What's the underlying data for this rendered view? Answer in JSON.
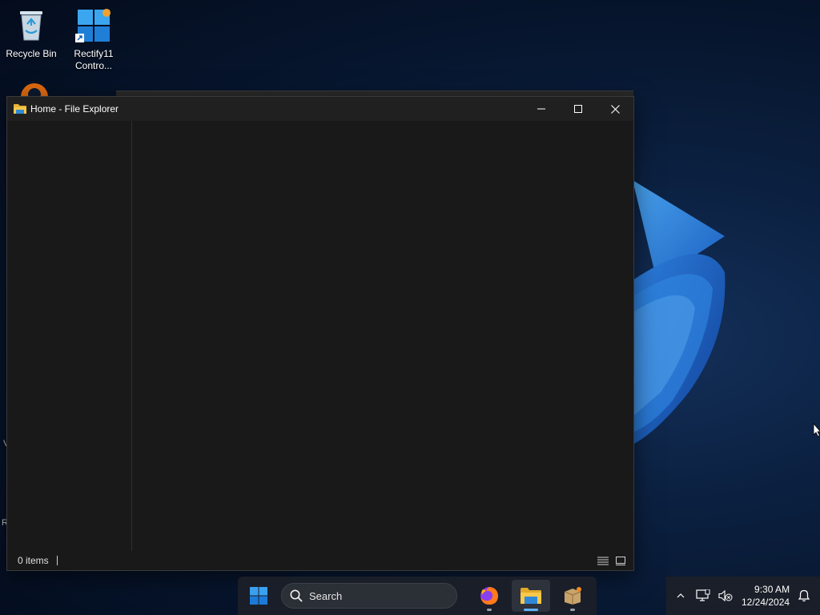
{
  "desktop": {
    "icons": [
      {
        "label": "Recycle Bin",
        "icon": "recycle-bin-icon"
      },
      {
        "label": "Rectify11",
        "label2": "Contro...",
        "icon": "rectify11-control-panel-icon"
      }
    ],
    "edge_fragments": [
      "V",
      "R"
    ]
  },
  "window": {
    "title": "Home - File Explorer",
    "icon": "folder-icon",
    "controls": {
      "minimize": "minimize-icon",
      "maximize": "maximize-icon",
      "close": "close-icon"
    },
    "status": {
      "item_count": "0 items"
    }
  },
  "taskbar": {
    "search_label": "Search",
    "apps": [
      {
        "name": "Firefox",
        "icon": "firefox-icon",
        "active": false
      },
      {
        "name": "File Explorer",
        "icon": "file-explorer-icon",
        "active": true
      },
      {
        "name": "Package",
        "icon": "package-icon",
        "active": false
      }
    ],
    "clock": {
      "time": "9:30 AM",
      "date": "12/24/2024"
    }
  },
  "colors": {
    "accent": "#5fb3f6",
    "window_bg": "#191919",
    "titlebar_bg": "#202020"
  }
}
